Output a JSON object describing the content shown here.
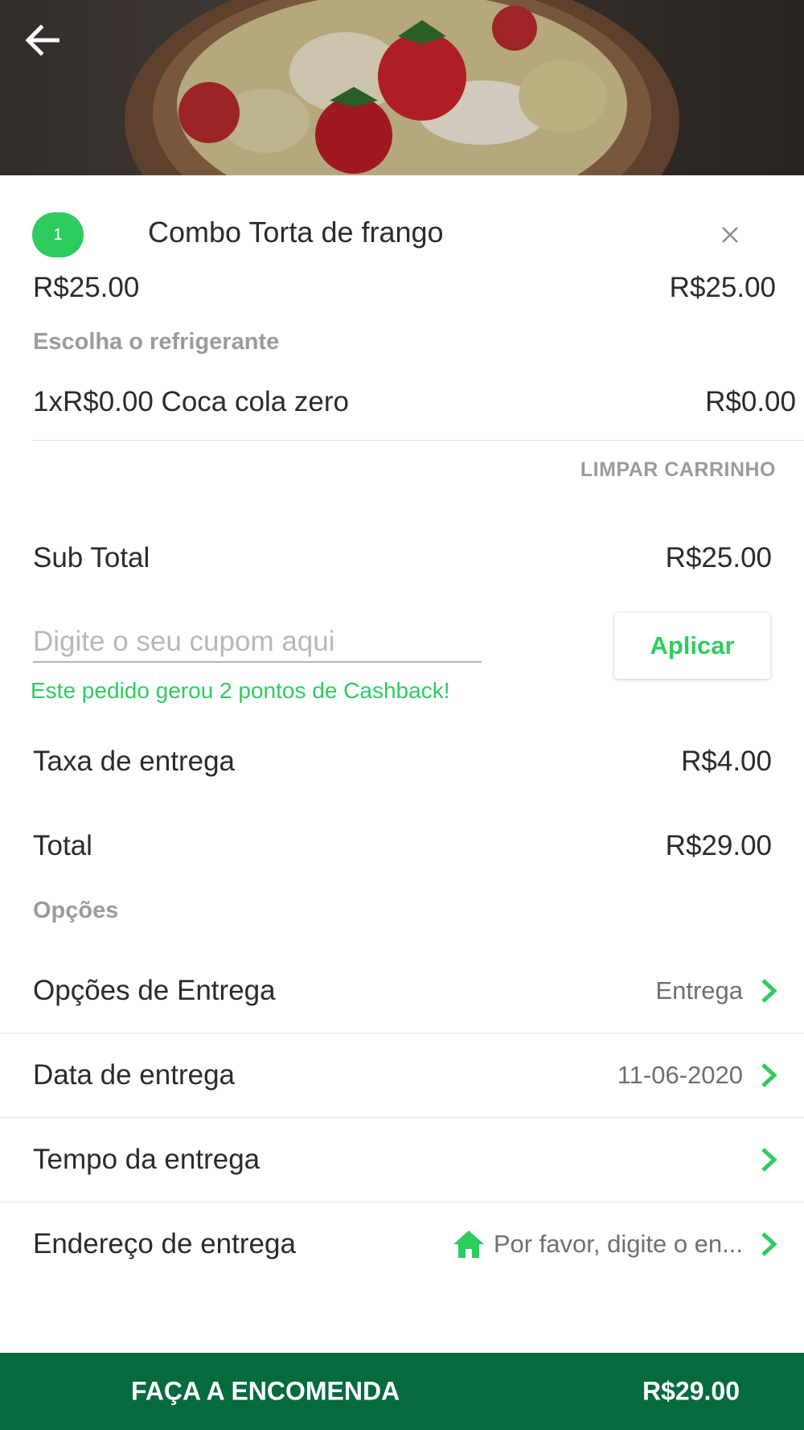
{
  "colors": {
    "accent": "#2ecc5f",
    "order_bar": "#046b3e",
    "muted": "#9b9b9b",
    "text": "#2b2b2b"
  },
  "header": {
    "back_icon": "arrow-left-icon",
    "hero_image": "food-photo-strawberry-bowl"
  },
  "cart_item": {
    "quantity": "1",
    "name": "Combo Torta de frango",
    "unit_price": "R$25.00",
    "line_total": "R$25.00",
    "close_icon": "close-icon",
    "option_group_label": "Escolha o refrigerante",
    "addon": {
      "text": "1xR$0.00 Coca cola zero",
      "price": "R$0.00"
    }
  },
  "clear_cart_label": "LIMPAR CARRINHO",
  "summary": {
    "subtotal_label": "Sub Total",
    "subtotal_value": "R$25.00",
    "coupon_placeholder": "Digite o seu cupom aqui",
    "coupon_value": "",
    "apply_label": "Aplicar",
    "cashback_message": "Este pedido gerou 2 pontos de Cashback!",
    "delivery_fee_label": "Taxa de entrega",
    "delivery_fee_value": "R$4.00",
    "total_label": "Total",
    "total_value": "R$29.00"
  },
  "options": {
    "section_label": "Opções",
    "items": [
      {
        "label": "Opções de Entrega",
        "value": "Entrega",
        "icon": "chevron-right-icon"
      },
      {
        "label": "Data de entrega",
        "value": "11-06-2020",
        "icon": "chevron-right-icon"
      },
      {
        "label": "Tempo da entrega",
        "value": "",
        "icon": "chevron-right-icon"
      },
      {
        "label": "Endereço de entrega",
        "value": "Por favor, digite o en...",
        "leading_icon": "home-icon",
        "icon": "chevron-right-icon"
      }
    ]
  },
  "order_button": {
    "label": "FAÇA A ENCOMENDA",
    "total": "R$29.00"
  }
}
